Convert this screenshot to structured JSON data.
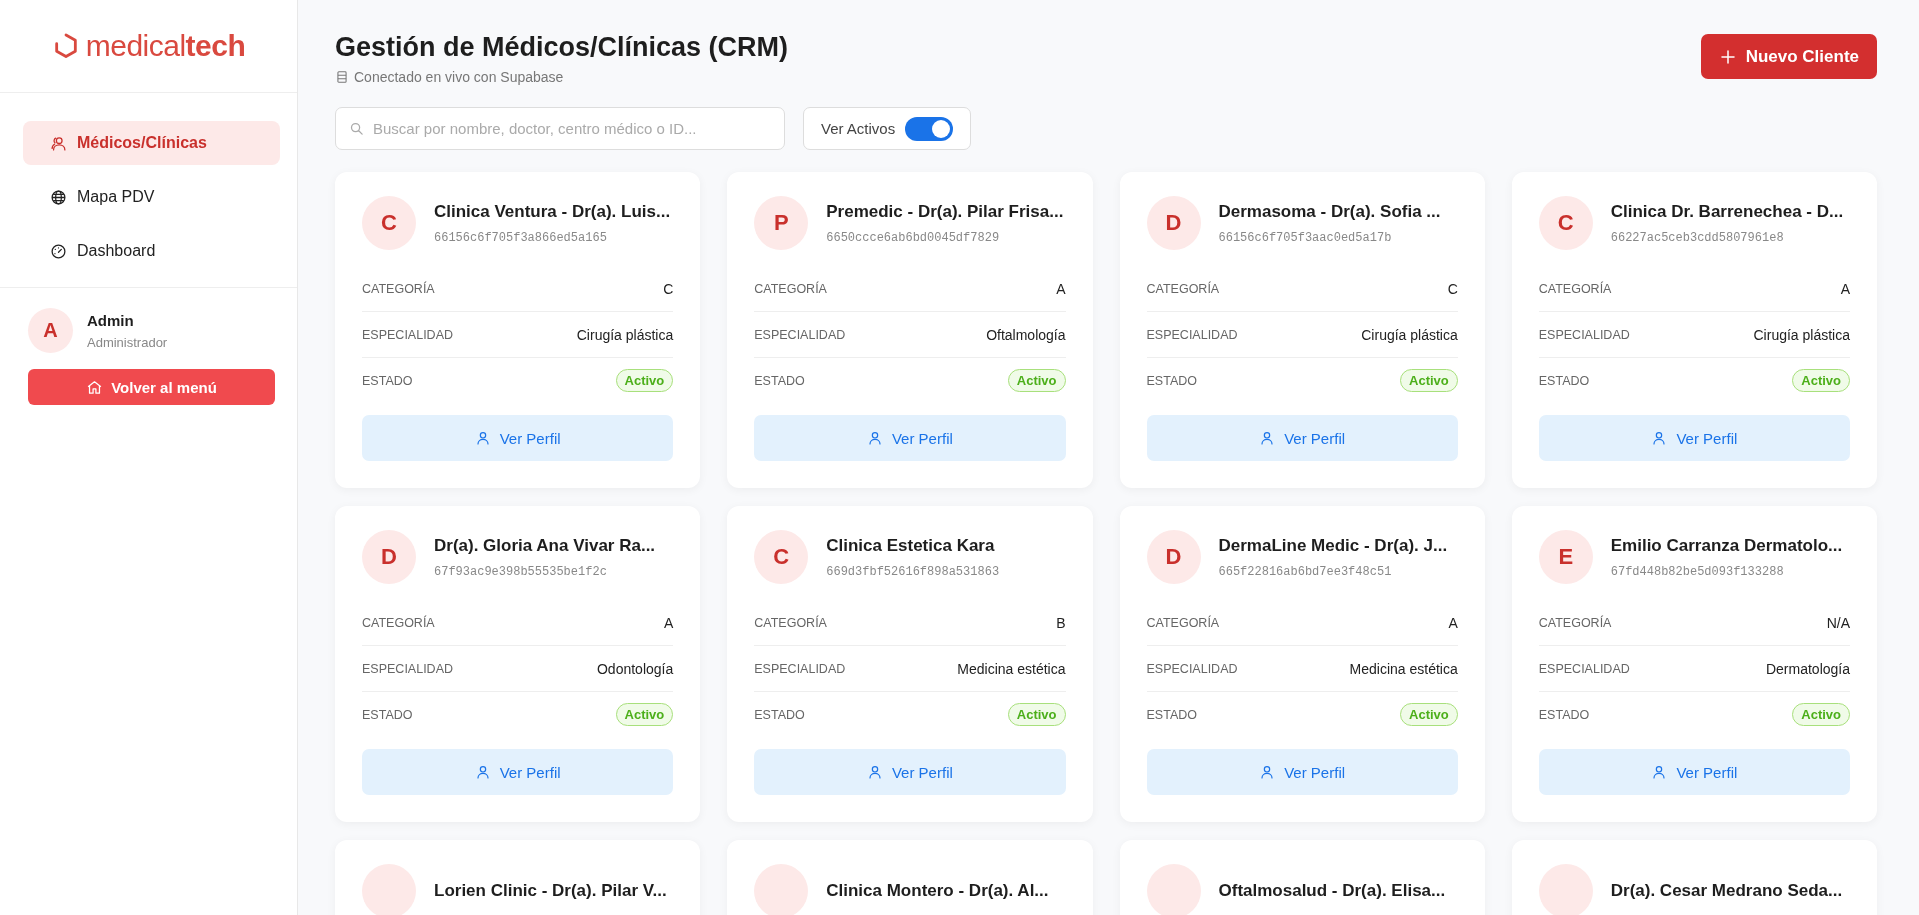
{
  "sidebar": {
    "logo": {
      "light": "medical",
      "bold": "tech"
    },
    "nav": [
      {
        "label": "Médicos/Clínicas",
        "selected": true
      },
      {
        "label": "Mapa PDV",
        "selected": false
      },
      {
        "label": "Dashboard",
        "selected": false
      }
    ],
    "user": {
      "initial": "A",
      "name": "Admin",
      "role": "Administrador"
    },
    "back_button": "Volver al menú"
  },
  "header": {
    "title": "Gestión de Médicos/Clínicas (CRM)",
    "subtitle": "Conectado en vivo con Supabase",
    "new_button": "Nuevo Cliente"
  },
  "search": {
    "placeholder": "Buscar por nombre, doctor, centro médico o ID..."
  },
  "toggle": {
    "label": "Ver Activos",
    "on": true
  },
  "cards": [
    {
      "initial": "C",
      "name": "Clinica Ventura - Dr(a). Luis...",
      "id": "66156c6f705f3a866ed5a165",
      "fields": [
        {
          "label": "CATEGORÍA",
          "value": "C"
        },
        {
          "label": "ESPECIALIDAD",
          "value": "Cirugía plástica"
        }
      ],
      "status": {
        "label": "ESTADO",
        "value": "Activo",
        "active": true
      },
      "button": "Ver Perfil"
    },
    {
      "initial": "P",
      "name": "Premedic - Dr(a). Pilar Frisa...",
      "id": "6650ccce6ab6bd0045df7829",
      "fields": [
        {
          "label": "CATEGORÍA",
          "value": "A"
        },
        {
          "label": "ESPECIALIDAD",
          "value": "Oftalmología"
        }
      ],
      "status": {
        "label": "ESTADO",
        "value": "Activo",
        "active": true
      },
      "button": "Ver Perfil"
    },
    {
      "initial": "D",
      "name": "Dermasoma - Dr(a). Sofia ...",
      "id": "66156c6f705f3aac0ed5a17b",
      "fields": [
        {
          "label": "CATEGORÍA",
          "value": "C"
        },
        {
          "label": "ESPECIALIDAD",
          "value": "Cirugía plástica"
        }
      ],
      "status": {
        "label": "ESTADO",
        "value": "Activo",
        "active": true
      },
      "button": "Ver Perfil"
    },
    {
      "initial": "C",
      "name": "Clinica Dr. Barrenechea - D...",
      "id": "66227ac5ceb3cdd5807961e8",
      "fields": [
        {
          "label": "CATEGORÍA",
          "value": "A"
        },
        {
          "label": "ESPECIALIDAD",
          "value": "Cirugía plástica"
        }
      ],
      "status": {
        "label": "ESTADO",
        "value": "Activo",
        "active": true
      },
      "button": "Ver Perfil"
    },
    {
      "initial": "D",
      "name": "Dr(a). Gloria Ana Vivar Ra...",
      "id": "67f93ac9e398b55535be1f2c",
      "fields": [
        {
          "label": "CATEGORÍA",
          "value": "A"
        },
        {
          "label": "ESPECIALIDAD",
          "value": "Odontología"
        }
      ],
      "status": {
        "label": "ESTADO",
        "value": "Activo",
        "active": true
      },
      "button": "Ver Perfil"
    },
    {
      "initial": "C",
      "name": "Clinica Estetica Kara",
      "id": "669d3fbf52616f898a531863",
      "fields": [
        {
          "label": "CATEGORÍA",
          "value": "B"
        },
        {
          "label": "ESPECIALIDAD",
          "value": "Medicina estética"
        }
      ],
      "status": {
        "label": "ESTADO",
        "value": "Activo",
        "active": true
      },
      "button": "Ver Perfil"
    },
    {
      "initial": "D",
      "name": "DermaLine Medic - Dr(a). J...",
      "id": "665f22816ab6bd7ee3f48c51",
      "fields": [
        {
          "label": "CATEGORÍA",
          "value": "A"
        },
        {
          "label": "ESPECIALIDAD",
          "value": "Medicina estética"
        }
      ],
      "status": {
        "label": "ESTADO",
        "value": "Activo",
        "active": true
      },
      "button": "Ver Perfil"
    },
    {
      "initial": "E",
      "name": "Emilio Carranza Dermatolo...",
      "id": "67fd448b82be5d093f133288",
      "fields": [
        {
          "label": "CATEGORÍA",
          "value": "N/A"
        },
        {
          "label": "ESPECIALIDAD",
          "value": "Dermatología"
        }
      ],
      "status": {
        "label": "ESTADO",
        "value": "Activo",
        "active": true
      },
      "button": "Ver Perfil"
    },
    {
      "name": "Lorien Clinic - Dr(a). Pilar V..."
    },
    {
      "name": "Clinica Montero - Dr(a). Al..."
    },
    {
      "name": "Oftalmosalud - Dr(a). Elisa..."
    },
    {
      "name": "Dr(a). Cesar Medrano Seda..."
    }
  ]
}
